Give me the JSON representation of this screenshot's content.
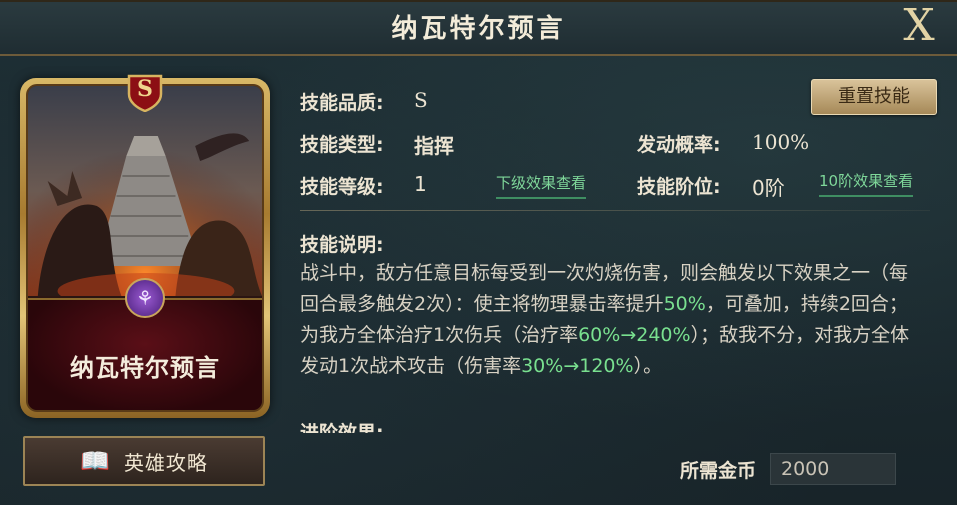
{
  "title": "纳瓦特尔预言",
  "close_label": "X",
  "card": {
    "grade": "S",
    "name": "纳瓦特尔预言"
  },
  "guide_button": {
    "label": "英雄攻略",
    "icon": "book-icon"
  },
  "info": {
    "quality_label": "技能品质:",
    "quality_value": "S",
    "type_label": "技能类型:",
    "type_value": "指挥",
    "chance_label": "发动概率:",
    "chance_value": "100%",
    "level_label": "技能等级:",
    "level_value": "1",
    "next_level_link": "下级效果查看",
    "rank_label": "技能阶位:",
    "rank_value": "0阶",
    "rank10_link": "10阶效果查看",
    "reset_button": "重置技能"
  },
  "description": {
    "title": "技能说明:",
    "seg1": "战斗中，敌方任意目标每受到一次灼烧伤害，则会触发以下效果之一（每回合最多触发2次）：使主将物理暴击率提升",
    "hl1": "50%",
    "seg2": "，可叠加，持续2回合；为我方全体治疗1次伤兵（治疗率",
    "hl2": "60%→240%",
    "seg3": "）；敌我不分，对我方全体发动1次战术攻击（伤害率",
    "hl3": "30%→120%",
    "seg4": "）。"
  },
  "advance_title": "进阶效果:",
  "cost": {
    "label": "所需金币",
    "value": "2000"
  },
  "colors": {
    "highlight": "#79e08f",
    "gold": "#c8a55c",
    "card_red": "#5a0f17"
  }
}
